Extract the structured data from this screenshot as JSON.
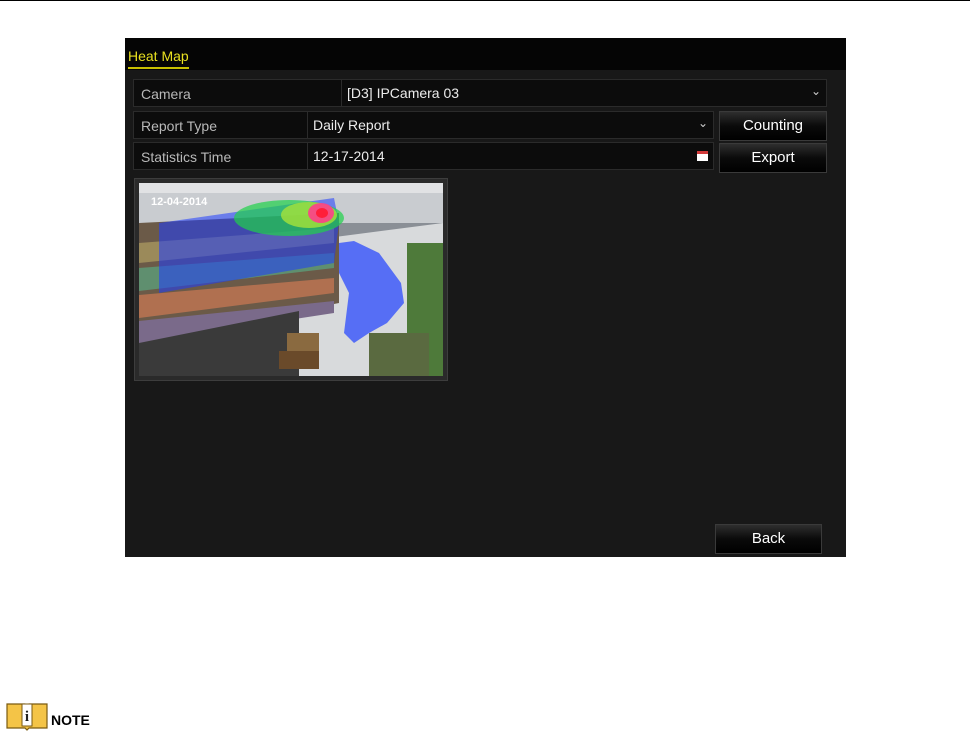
{
  "window": {
    "title": "Heat Map"
  },
  "form": {
    "camera": {
      "label": "Camera",
      "value": "[D3] IPCamera 03"
    },
    "report_type": {
      "label": "Report Type",
      "value": "Daily Report"
    },
    "statistics_time": {
      "label": "Statistics Time",
      "value": "12-17-2014"
    }
  },
  "buttons": {
    "counting": "Counting",
    "export": "Export",
    "back": "Back"
  },
  "thumbnail": {
    "timestamp": "12-04-2014"
  },
  "note": {
    "label": "NOTE"
  },
  "icons": {
    "dropdown": "chevron-down-icon",
    "calendar": "calendar-icon",
    "note": "info-book-icon"
  }
}
